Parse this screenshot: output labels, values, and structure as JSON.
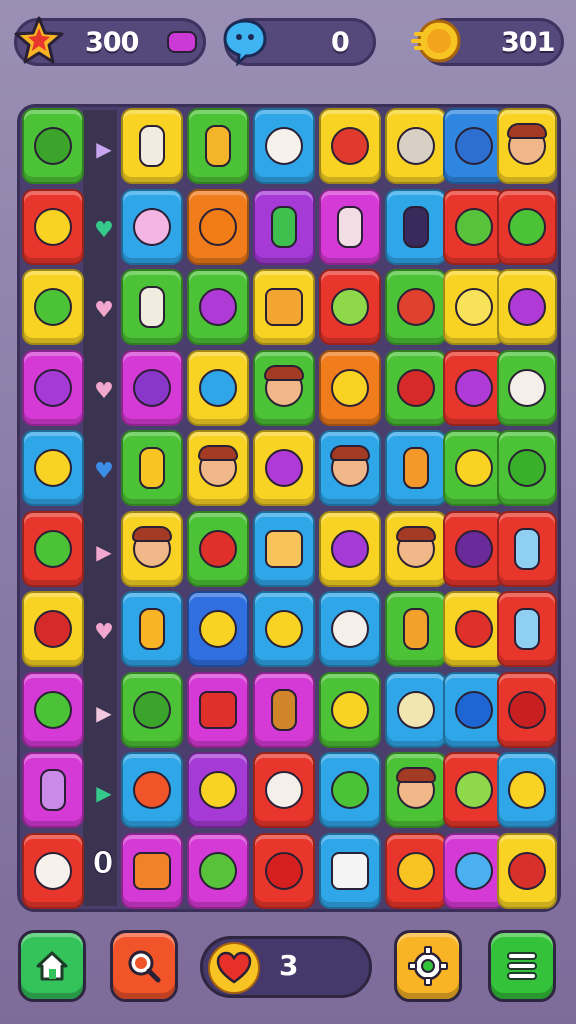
{
  "hud": {
    "stars": {
      "icon": "star-icon",
      "value": "300"
    },
    "bubbles": {
      "icon": "chat-bubble-icon",
      "value": "0"
    },
    "coins": {
      "icon": "coin-icon",
      "value": "301"
    }
  },
  "board": {
    "lane_arrows": [
      {
        "icon": "triangle-arrow-icon",
        "glyph": "▶",
        "color": "#c9a6f2"
      },
      {
        "icon": "heart-arrow-icon",
        "glyph": "♥",
        "color": "#35c98a"
      },
      {
        "icon": "heart-arrow-icon",
        "glyph": "♥",
        "color": "#f2a7cf"
      },
      {
        "icon": "heart-arrow-icon",
        "glyph": "♥",
        "color": "#f2a7cf"
      },
      {
        "icon": "heart-arrow-icon",
        "glyph": "♥",
        "color": "#3b8de8"
      },
      {
        "icon": "triangle-arrow-icon",
        "glyph": "▶",
        "color": "#f2a7cf"
      },
      {
        "icon": "heart-arrow-icon",
        "glyph": "♥",
        "color": "#f2a7cf"
      },
      {
        "icon": "triangle-arrow-icon",
        "glyph": "▶",
        "color": "#f2c6df"
      },
      {
        "icon": "triangle-arrow-icon",
        "glyph": "▶",
        "color": "#35c98a"
      }
    ],
    "lane_counter": "0",
    "rows": [
      [
        {
          "color": "#4cc236",
          "item": "green-fruit-icon",
          "ic": "#3aa52a",
          "shape": "round"
        },
        {
          "color": "#f8d324",
          "item": "bottle-icon",
          "ic": "#f2ece0",
          "shape": "tall"
        },
        {
          "color": "#4cc236",
          "item": "juice-box-icon",
          "ic": "#f4b42a",
          "shape": "tall"
        },
        {
          "color": "#2fa6e8",
          "item": "cupcake-icon",
          "ic": "#f7f1ec",
          "shape": "round"
        },
        {
          "color": "#f8d324",
          "item": "cake-icon",
          "ic": "#e03a2e",
          "shape": "round"
        },
        {
          "color": "#f8d324",
          "item": "donut-icon",
          "ic": "#d8d0c4",
          "shape": "round"
        },
        {
          "color": "#2f86e0",
          "item": "swirl-candy-icon",
          "ic": "#2d6fd0",
          "shape": "round"
        },
        {
          "color": "#f8d324",
          "item": "character-face-icon",
          "ic": "#f0b889",
          "shape": "face"
        }
      ],
      [
        {
          "color": "#e8362c",
          "item": "yellow-fruit-icon",
          "ic": "#f8d324",
          "shape": "round"
        },
        {
          "color": "#2fa6e8",
          "item": "ice-cream-cup-icon",
          "ic": "#f3b6e4",
          "shape": "round"
        },
        {
          "color": "#f07c1c",
          "item": "mango-icon",
          "ic": "#f27c16",
          "shape": "round"
        },
        {
          "color": "#a53ad6",
          "item": "soda-cup-icon",
          "ic": "#3fbf4e",
          "shape": "tall"
        },
        {
          "color": "#d63ad6",
          "item": "jar-icon",
          "ic": "#f2dde4",
          "shape": "tall"
        },
        {
          "color": "#2fa6e8",
          "item": "wine-bottle-icon",
          "ic": "#3a2a5c",
          "shape": "tall"
        },
        {
          "color": "#e8362c",
          "item": "leaf-icon",
          "ic": "#58c23a",
          "shape": "round"
        },
        {
          "color": "#e8362c",
          "item": "green-heart-icon",
          "ic": "#4cc236",
          "shape": "round"
        }
      ],
      [
        {
          "color": "#f8d324",
          "item": "leaf-bundle-icon",
          "ic": "#4cc236",
          "shape": "round"
        },
        {
          "color": "#4cc236",
          "item": "milk-bottle-icon",
          "ic": "#f2ece0",
          "shape": "tall"
        },
        {
          "color": "#4cc236",
          "item": "purple-swirl-icon",
          "ic": "#b03ad6",
          "shape": "round"
        },
        {
          "color": "#f8d324",
          "item": "waffle-icon",
          "ic": "#f2a530",
          "shape": "square"
        },
        {
          "color": "#e8362c",
          "item": "salad-bowl-icon",
          "ic": "#8fd84a",
          "shape": "round"
        },
        {
          "color": "#4cc236",
          "item": "red-onion-icon",
          "ic": "#e0402e",
          "shape": "round"
        },
        {
          "color": "#f8d324",
          "item": "glove-icon",
          "ic": "#f8e25a",
          "shape": "round"
        },
        {
          "color": "#f8d324",
          "item": "grape-bunch-icon",
          "ic": "#b03ad6",
          "shape": "round"
        }
      ],
      [
        {
          "color": "#d63ad6",
          "item": "eggplant-icon",
          "ic": "#a53ad6",
          "shape": "round"
        },
        {
          "color": "#d63ad6",
          "item": "plum-icon",
          "ic": "#8a36c8",
          "shape": "round"
        },
        {
          "color": "#f8d324",
          "item": "blue-berry-icon",
          "ic": "#2fa6e8",
          "shape": "round"
        },
        {
          "color": "#4cc236",
          "item": "character-face-icon",
          "ic": "#f0b889",
          "shape": "face"
        },
        {
          "color": "#f07c1c",
          "item": "lemon-icon",
          "ic": "#f8d324",
          "shape": "round"
        },
        {
          "color": "#4cc236",
          "item": "red-pepper-icon",
          "ic": "#d62a2a",
          "shape": "round"
        },
        {
          "color": "#e8362c",
          "item": "purple-apple-icon",
          "ic": "#b03ad6",
          "shape": "round"
        },
        {
          "color": "#4cc236",
          "item": "ghost-icon",
          "ic": "#f4efe8",
          "shape": "round"
        }
      ],
      [
        {
          "color": "#2fa6e8",
          "item": "banana-icon",
          "ic": "#f8d324",
          "shape": "round"
        },
        {
          "color": "#4cc236",
          "item": "honey-jar-icon",
          "ic": "#f8c424",
          "shape": "tall"
        },
        {
          "color": "#f8d324",
          "item": "character-face-icon",
          "ic": "#f0b889",
          "shape": "face"
        },
        {
          "color": "#f8d324",
          "item": "turnip-icon",
          "ic": "#b03ad6",
          "shape": "round"
        },
        {
          "color": "#2fa6e8",
          "item": "character-face-icon",
          "ic": "#f0b889",
          "shape": "face"
        },
        {
          "color": "#2fa6e8",
          "item": "juice-carton-icon",
          "ic": "#f2992a",
          "shape": "tall"
        },
        {
          "color": "#4cc236",
          "item": "banana-icon",
          "ic": "#f8d324",
          "shape": "round"
        },
        {
          "color": "#4cc236",
          "item": "green-letter-icon",
          "ic": "#3ab02a",
          "shape": "round"
        }
      ],
      [
        {
          "color": "#e8362c",
          "item": "green-leaf-icon",
          "ic": "#4cc236",
          "shape": "round"
        },
        {
          "color": "#f8d324",
          "item": "character-face-icon",
          "ic": "#f0b889",
          "shape": "face"
        },
        {
          "color": "#4cc236",
          "item": "red-apple-icon",
          "ic": "#e0302a",
          "shape": "round"
        },
        {
          "color": "#2fa6e8",
          "item": "toast-face-icon",
          "ic": "#f8c45a",
          "shape": "square"
        },
        {
          "color": "#f8d324",
          "item": "grape-icon",
          "ic": "#a53ad6",
          "shape": "round"
        },
        {
          "color": "#f8d324",
          "item": "character-face-icon",
          "ic": "#f0b889",
          "shape": "face"
        },
        {
          "color": "#e8362c",
          "item": "plum-icon",
          "ic": "#6a2a9a",
          "shape": "round"
        },
        {
          "color": "#e8362c",
          "item": "glass-icon",
          "ic": "#8fd0f2",
          "shape": "tall"
        }
      ],
      [
        {
          "color": "#f8d324",
          "item": "pomegranate-icon",
          "ic": "#d62a2a",
          "shape": "round"
        },
        {
          "color": "#2fa6e8",
          "item": "honey-bottle-icon",
          "ic": "#f8b424",
          "shape": "tall"
        },
        {
          "color": "#2f6fe0",
          "item": "banana-peel-icon",
          "ic": "#f8d324",
          "shape": "round"
        },
        {
          "color": "#2fa6e8",
          "item": "yellow-heart-icon",
          "ic": "#f8d324",
          "shape": "round"
        },
        {
          "color": "#2fa6e8",
          "item": "ghost-icon",
          "ic": "#f4efe8",
          "shape": "round"
        },
        {
          "color": "#4cc236",
          "item": "juice-box-icon",
          "ic": "#f2a22a",
          "shape": "tall"
        },
        {
          "color": "#f8d324",
          "item": "strawberry-icon",
          "ic": "#e0302a",
          "shape": "round"
        },
        {
          "color": "#e8362c",
          "item": "drink-cup-icon",
          "ic": "#8fd0f2",
          "shape": "tall"
        }
      ],
      [
        {
          "color": "#d63ad6",
          "item": "cucumber-icon",
          "ic": "#4cc236",
          "shape": "round"
        },
        {
          "color": "#4cc236",
          "item": "watermelon-icon",
          "ic": "#3aa52a",
          "shape": "round"
        },
        {
          "color": "#d63ad6",
          "item": "red-box-icon",
          "ic": "#e0302a",
          "shape": "square"
        },
        {
          "color": "#d63ad6",
          "item": "jam-jar-icon",
          "ic": "#d0852a",
          "shape": "tall"
        },
        {
          "color": "#4cc236",
          "item": "yellow-bean-icon",
          "ic": "#f8d324",
          "shape": "round"
        },
        {
          "color": "#2fa6e8",
          "item": "garlic-icon",
          "ic": "#f2e6b0",
          "shape": "round"
        },
        {
          "color": "#2fa6e8",
          "item": "number-icon",
          "ic": "#1e66d4",
          "shape": "round"
        },
        {
          "color": "#e8362c",
          "item": "cherries-icon",
          "ic": "#c82020",
          "shape": "round"
        }
      ],
      [
        {
          "color": "#d63ad6",
          "item": "jar-icon",
          "ic": "#c98ae8",
          "shape": "tall"
        },
        {
          "color": "#2fa6e8",
          "item": "carrot-icon",
          "ic": "#f2542a",
          "shape": "round"
        },
        {
          "color": "#a53ad6",
          "item": "banana-icon",
          "ic": "#f8d324",
          "shape": "round"
        },
        {
          "color": "#e8362c",
          "item": "ghost-icon",
          "ic": "#f4efe8",
          "shape": "round"
        },
        {
          "color": "#2fa6e8",
          "item": "cucumber-icon",
          "ic": "#4cc236",
          "shape": "round"
        },
        {
          "color": "#4cc236",
          "item": "character-face-icon",
          "ic": "#f0b889",
          "shape": "face"
        },
        {
          "color": "#e8362c",
          "item": "green-egg-icon",
          "ic": "#8fd84a",
          "shape": "round"
        },
        {
          "color": "#2fa6e8",
          "item": "letter-q-icon",
          "ic": "#f8d324",
          "shape": "round"
        }
      ],
      [
        {
          "color": "#e8362c",
          "item": "ice-cream-icon",
          "ic": "#f7f1ec",
          "shape": "round"
        },
        {
          "color": "#d63ad6",
          "item": "chips-icon",
          "ic": "#f2822a",
          "shape": "square"
        },
        {
          "color": "#d63ad6",
          "item": "green-leaf-icon",
          "ic": "#58c23a",
          "shape": "round"
        },
        {
          "color": "#e8362c",
          "item": "red-heart-icon",
          "ic": "#d62020",
          "shape": "round"
        },
        {
          "color": "#2fa6e8",
          "item": "receipt-icon",
          "ic": "#f4f4f4",
          "shape": "square"
        },
        {
          "color": "#e8362c",
          "item": "lemon-icon",
          "ic": "#f8c424",
          "shape": "round"
        },
        {
          "color": "#d63ad6",
          "item": "blue-bear-icon",
          "ic": "#4ab0f0",
          "shape": "round"
        },
        {
          "color": "#f8d324",
          "item": "meat-icon",
          "ic": "#d8302a",
          "shape": "round"
        }
      ]
    ]
  },
  "toolbar": {
    "home": {
      "icon": "home-icon",
      "color": "#34c25a"
    },
    "search": {
      "icon": "search-icon",
      "color": "#f2542a"
    },
    "lives": {
      "icon": "heart-icon",
      "value": "3"
    },
    "settings": {
      "icon": "gear-icon",
      "color": "#f8b424"
    },
    "menu": {
      "icon": "menu-icon",
      "color": "#34c23a"
    }
  }
}
